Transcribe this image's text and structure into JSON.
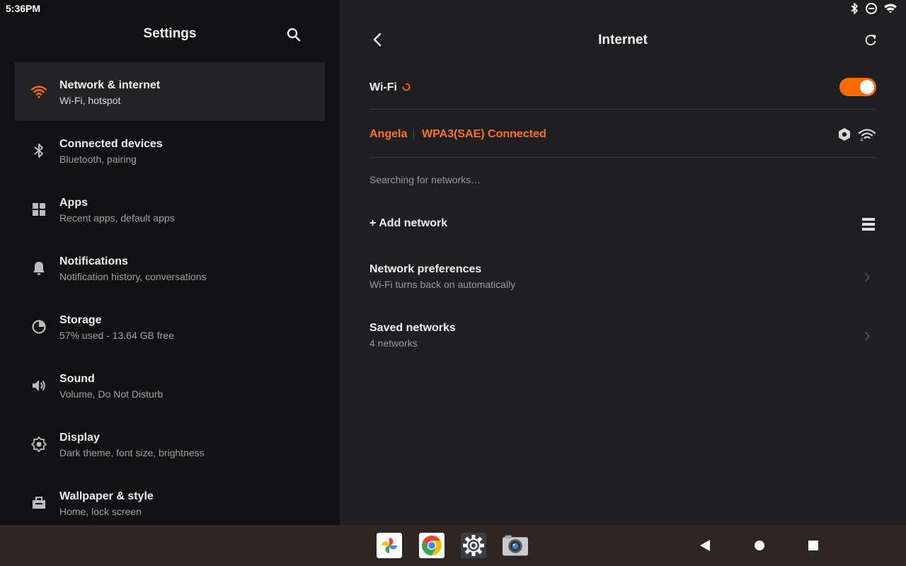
{
  "status_bar": {
    "time": "5:36PM",
    "icons": [
      "bluetooth-icon",
      "do-not-disturb-icon",
      "wifi-icon"
    ]
  },
  "settings_panel": {
    "title": "Settings",
    "search_icon": "search-icon",
    "items": [
      {
        "title": "Network & internet",
        "subtitle": "Wi-Fi, hotspot",
        "icon": "wifi-icon",
        "active": true
      },
      {
        "title": "Connected devices",
        "subtitle": "Bluetooth, pairing",
        "icon": "bluetooth-icon"
      },
      {
        "title": "Apps",
        "subtitle": "Recent apps, default apps",
        "icon": "apps-grid-icon"
      },
      {
        "title": "Notifications",
        "subtitle": "Notification history, conversations",
        "icon": "bell-icon"
      },
      {
        "title": "Storage",
        "subtitle": "57% used - 13.64 GB free",
        "icon": "storage-pie-icon"
      },
      {
        "title": "Sound",
        "subtitle": "Volume, Do Not Disturb",
        "icon": "speaker-icon"
      },
      {
        "title": "Display",
        "subtitle": "Dark theme, font size, brightness",
        "icon": "brightness-icon"
      },
      {
        "title": "Wallpaper & style",
        "subtitle": "Home, lock screen",
        "icon": "wallpaper-icon"
      }
    ]
  },
  "internet_panel": {
    "title": "Internet",
    "wifi": {
      "label": "Wi-Fi",
      "enabled": true
    },
    "connected": {
      "name": "Angela",
      "status": "WPA3(SAE) Connected"
    },
    "searching_text": "Searching for networks…",
    "add_network": "+ Add network",
    "network_preferences": {
      "title": "Network preferences",
      "subtitle": "Wi-Fi turns back on automatically"
    },
    "saved_networks": {
      "title": "Saved networks",
      "subtitle": "4 networks"
    }
  },
  "taskbar": {
    "apps": [
      "photos-app-icon",
      "chrome-app-icon",
      "settings-app-icon",
      "camera-app-icon"
    ],
    "nav": [
      "back-nav-icon",
      "home-nav-icon",
      "recents-nav-icon"
    ]
  },
  "colors": {
    "accent": "#ff6a00",
    "left_bg": "#111113",
    "right_bg": "#1f1f22",
    "taskbar_bg": "#2f2623"
  }
}
